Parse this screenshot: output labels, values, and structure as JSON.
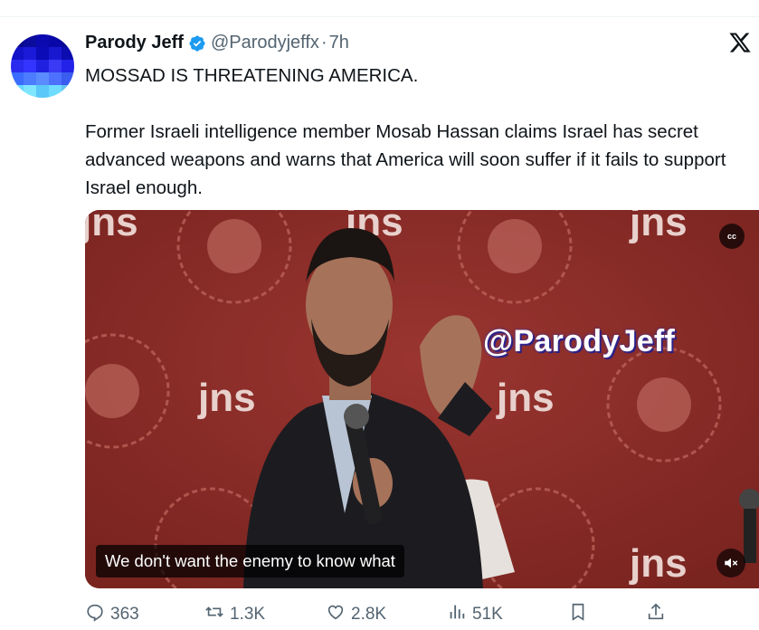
{
  "author": {
    "name": "Parody Jeff",
    "handle": "@Parodyjeffx",
    "separator": "·",
    "time": "7h"
  },
  "tweet": {
    "line1": "MOSSAD IS THREATENING AMERICA.",
    "body": "Former Israeli intelligence member Mosab Hassan claims Israel has secret advanced weapons and warns that America will soon suffer if it fails to support Israel enough."
  },
  "media": {
    "caption": "We don't want the enemy to know what",
    "overlay_handle": "@ParodyJeff",
    "backdrop_logo": "jns",
    "cc_label": "cc",
    "background_color": "#8b2b26"
  },
  "actions": {
    "replies": "363",
    "reposts": "1.3K",
    "likes": "2.8K",
    "views": "51K"
  },
  "icons": [
    "verified-badge-icon",
    "x-logo-icon",
    "reply-icon",
    "repost-icon",
    "like-icon",
    "views-icon",
    "bookmark-icon",
    "share-icon",
    "closed-captions-icon",
    "mute-icon"
  ],
  "colors": {
    "verified": "#1d9bf0",
    "secondary_text": "#536471",
    "text": "#0f1419"
  }
}
